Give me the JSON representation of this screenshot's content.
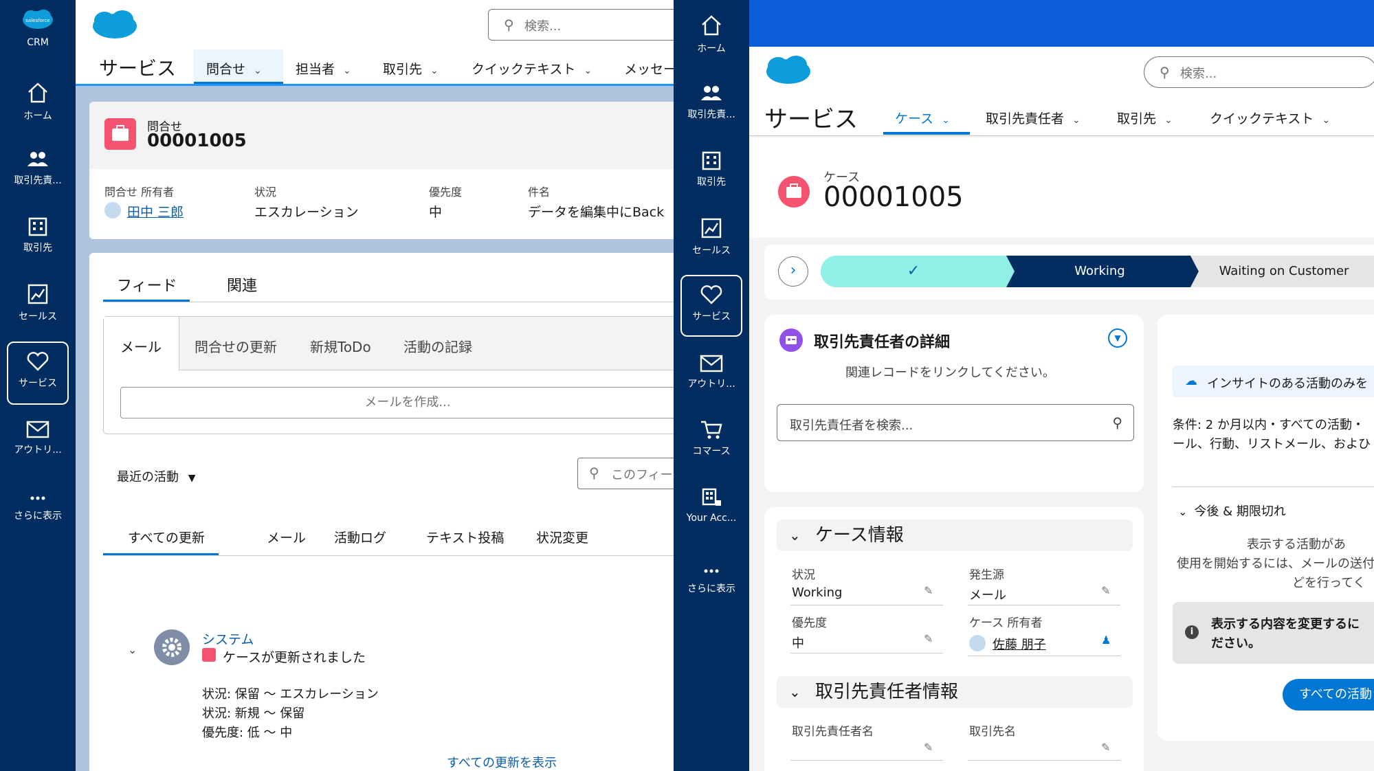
{
  "left_nav": {
    "logo_text": "salesforce",
    "app_label": "CRM",
    "items": [
      {
        "label": "ホーム",
        "icon": "home-icon"
      },
      {
        "label": "取引先責...",
        "icon": "contacts-icon"
      },
      {
        "label": "取引先",
        "icon": "building-icon"
      },
      {
        "label": "セールス",
        "icon": "chart-icon"
      },
      {
        "label": "サービス",
        "icon": "heart-icon"
      },
      {
        "label": "アウトリ...",
        "icon": "mail-icon"
      },
      {
        "label": "さらに表示",
        "icon": "more-icon"
      }
    ]
  },
  "left_app": {
    "search_placeholder": "検索...",
    "app_name": "サービス",
    "tabs": [
      "問合せ",
      "担当者",
      "取引先",
      "クイックテキスト",
      "メッセー"
    ],
    "record": {
      "object_label": "問合せ",
      "number": "00001005"
    },
    "highlights": {
      "owner_label": "問合せ 所有者",
      "owner_value": "田中 三郎",
      "status_label": "状況",
      "status_value": "エスカレーション",
      "priority_label": "優先度",
      "priority_value": "中",
      "subject_label": "件名",
      "subject_value": "データを編集中にBack"
    },
    "main_tabs": [
      "フィード",
      "関連"
    ],
    "publisher_tabs": [
      "メール",
      "問合せの更新",
      "新規ToDo",
      "活動の記録"
    ],
    "compose_placeholder": "メールを作成...",
    "recent_label": "最近の活動",
    "feed_search_placeholder": "このフィー",
    "filter_tabs": [
      "すべての更新",
      "メール",
      "活動ログ",
      "テキスト投稿",
      "状況変更"
    ],
    "feed_item": {
      "actor": "システム",
      "message": "ケースが更新されました",
      "changes": [
        "状況: 保留 ～ エスカレーション",
        "状況: 新規 ～ 保留",
        "優先度: 低 ～ 中"
      ]
    },
    "show_all": "すべての更新を表示"
  },
  "right_nav": {
    "items": [
      {
        "label": "ホーム",
        "icon": "home-icon"
      },
      {
        "label": "取引先責...",
        "icon": "contacts-icon"
      },
      {
        "label": "取引先",
        "icon": "building-icon"
      },
      {
        "label": "セールス",
        "icon": "chart-icon"
      },
      {
        "label": "サービス",
        "icon": "heart-icon"
      },
      {
        "label": "アウトリ...",
        "icon": "mail-icon"
      },
      {
        "label": "コマース",
        "icon": "cart-icon"
      },
      {
        "label": "Your Acc...",
        "icon": "grid-icon"
      },
      {
        "label": "さらに表示",
        "icon": "more-icon"
      }
    ]
  },
  "right_app": {
    "search_placeholder": "検索...",
    "app_name": "サービス",
    "tabs": [
      "ケース",
      "取引先責任者",
      "取引先",
      "クイックテキスト"
    ],
    "record": {
      "object_label": "ケース",
      "number": "00001005"
    },
    "path": {
      "steps": [
        "Working",
        "Waiting on Customer"
      ]
    },
    "contact_card": {
      "title": "取引先責任者の詳細",
      "hint": "関連レコードをリンクしてください。",
      "search_placeholder": "取引先責任者を検索..."
    },
    "case_info": {
      "title": "ケース情報",
      "status_label": "状況",
      "status_value": "Working",
      "origin_label": "発生源",
      "origin_value": "メール",
      "priority_label": "優先度",
      "priority_value": "中",
      "owner_label": "ケース 所有者",
      "owner_value": "佐藤 朋子"
    },
    "contact_info": {
      "title": "取引先責任者情報",
      "contact_name_label": "取引先責任者名",
      "account_name_label": "取引先名"
    },
    "activity": {
      "insight_label": "インサイトのある活動のみを",
      "condition_line1": "条件: 2 か月以内・すべての活動・",
      "condition_line2": "ール、行動、リストメール、およひ",
      "upcoming_label": "今後 & 期限切れ",
      "empty_line1": "表示する活動があ",
      "empty_line2": "使用を開始するには、メールの送付",
      "empty_line3": "どを行ってく",
      "info_line1": "表示する内容を変更するに",
      "info_line2": "ださい。",
      "all_button": "すべての活動"
    }
  }
}
